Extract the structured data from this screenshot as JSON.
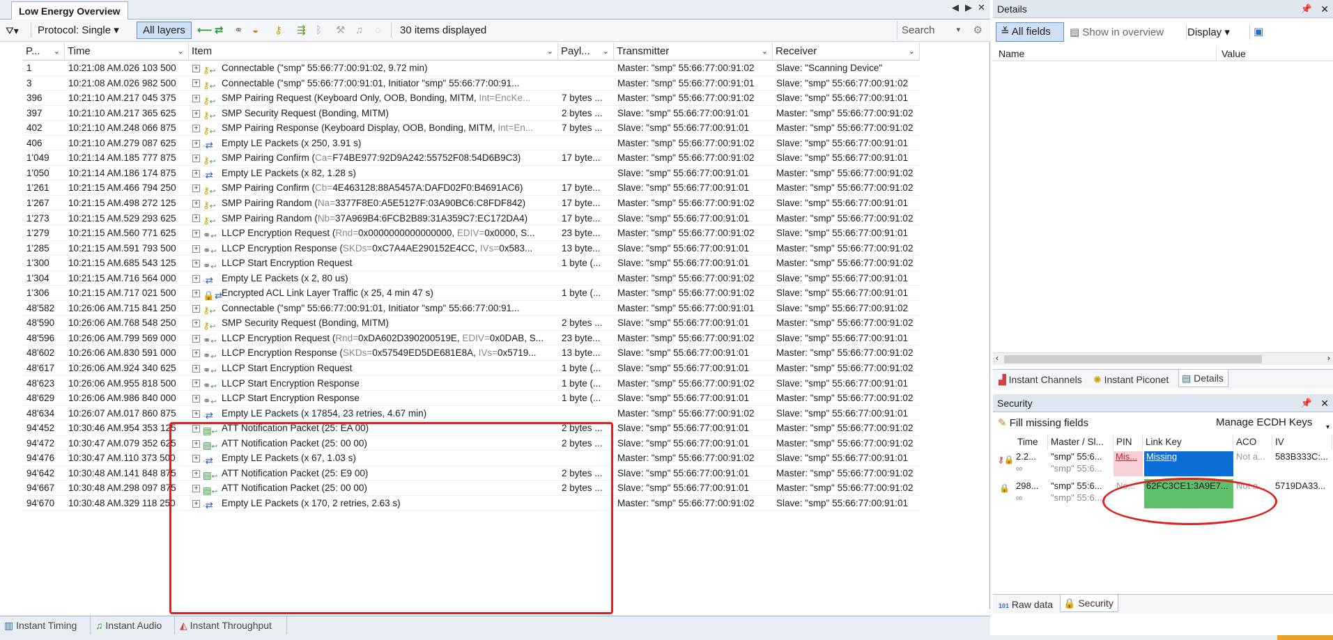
{
  "window": {
    "tab_title": "Low Energy Overview"
  },
  "toolbar": {
    "protocol_label": "Protocol: Single",
    "all_layers_label": "All layers",
    "items_displayed": "30 items displayed",
    "search_placeholder": "Search"
  },
  "columns": {
    "packet": "P...",
    "time": "Time",
    "item": "Item",
    "payload": "Payl...",
    "transmitter": "Transmitter",
    "receiver": "Receiver"
  },
  "rows": [
    {
      "p": "1",
      "t": "10:21:08 AM.026 103 500",
      "icon": "key",
      "item": "Connectable (\"smp\" 55:66:77:00:91:02, 9.72 min)",
      "pl": "",
      "tx": "Master: \"smp\" 55:66:77:00:91:02",
      "rx": "Slave: \"Scanning Device\""
    },
    {
      "p": "3",
      "t": "10:21:08 AM.026 982 500",
      "icon": "key",
      "item": "Connectable (\"smp\" 55:66:77:00:91:01, Initiator \"smp\" 55:66:77:00:91...",
      "pl": "",
      "tx": "Master: \"smp\" 55:66:77:00:91:01",
      "rx": "Slave: \"smp\" 55:66:77:00:91:02"
    },
    {
      "p": "396",
      "t": "10:21:10 AM.217 045 375",
      "icon": "key",
      "item": "SMP Pairing Request (Keyboard Only, OOB, Bonding, MITM, ",
      "gray": "Int=EncKe...",
      "pl": "7 bytes ...",
      "tx": "Master: \"smp\" 55:66:77:00:91:02",
      "rx": "Slave: \"smp\" 55:66:77:00:91:01"
    },
    {
      "p": "397",
      "t": "10:21:10 AM.217 365 625",
      "icon": "key",
      "item": "SMP Security Request (Bonding, MITM)",
      "pl": "2 bytes ...",
      "tx": "Slave: \"smp\" 55:66:77:00:91:01",
      "rx": "Master: \"smp\" 55:66:77:00:91:02"
    },
    {
      "p": "402",
      "t": "10:21:10 AM.248 066 875",
      "icon": "key",
      "item": "SMP Pairing Response (Keyboard Display, OOB, Bonding, MITM, ",
      "gray": "Int=En...",
      "pl": "7 bytes ...",
      "tx": "Slave: \"smp\" 55:66:77:00:91:01",
      "rx": "Master: \"smp\" 55:66:77:00:91:02"
    },
    {
      "p": "406",
      "t": "10:21:10 AM.279 087 625",
      "icon": "empty",
      "item": "Empty LE Packets (x 250, 3.91 s)",
      "pl": "",
      "tx": "Master: \"smp\" 55:66:77:00:91:02",
      "rx": "Slave: \"smp\" 55:66:77:00:91:01"
    },
    {
      "p": "1'049",
      "t": "10:21:14 AM.185 777 875",
      "icon": "key",
      "item": "SMP Pairing Confirm (",
      "gray": "Ca=",
      "rest": "F74BE977:92D9A242:55752F08:54D6B9C3)",
      "pl": "17 byte...",
      "tx": "Master: \"smp\" 55:66:77:00:91:02",
      "rx": "Slave: \"smp\" 55:66:77:00:91:01"
    },
    {
      "p": "1'050",
      "t": "10:21:14 AM.186 174 875",
      "icon": "empty",
      "item": "Empty LE Packets (x 82, 1.28 s)",
      "pl": "",
      "tx": "Slave: \"smp\" 55:66:77:00:91:01",
      "rx": "Master: \"smp\" 55:66:77:00:91:02"
    },
    {
      "p": "1'261",
      "t": "10:21:15 AM.466 794 250",
      "icon": "key",
      "item": "SMP Pairing Confirm (",
      "gray": "Cb=",
      "rest": "4E463128:88A5457A:DAFD02F0:B4691AC6)",
      "pl": "17 byte...",
      "tx": "Slave: \"smp\" 55:66:77:00:91:01",
      "rx": "Master: \"smp\" 55:66:77:00:91:02"
    },
    {
      "p": "1'267",
      "t": "10:21:15 AM.498 272 125",
      "icon": "key",
      "item": "SMP Pairing Random (",
      "gray": "Na=",
      "rest": "3377F8E0:A5E5127F:03A90BC6:C8FDF842)",
      "pl": "17 byte...",
      "tx": "Master: \"smp\" 55:66:77:00:91:02",
      "rx": "Slave: \"smp\" 55:66:77:00:91:01"
    },
    {
      "p": "1'273",
      "t": "10:21:15 AM.529 293 625",
      "icon": "key",
      "item": "SMP Pairing Random (",
      "gray": "Nb=",
      "rest": "37A969B4:6FCB2B89:31A359C7:EC172DA4)",
      "pl": "17 byte...",
      "tx": "Slave: \"smp\" 55:66:77:00:91:01",
      "rx": "Master: \"smp\" 55:66:77:00:91:02"
    },
    {
      "p": "1'279",
      "t": "10:21:15 AM.560 771 625",
      "icon": "llcp",
      "item": "LLCP Encryption Request (",
      "gray": "Rnd=",
      "rest": "0x0000000000000000, ",
      "gray2": "EDIV=",
      "rest2": "0x0000, S...",
      "pl": "23 byte...",
      "tx": "Master: \"smp\" 55:66:77:00:91:02",
      "rx": "Slave: \"smp\" 55:66:77:00:91:01"
    },
    {
      "p": "1'285",
      "t": "10:21:15 AM.591 793 500",
      "icon": "llcp",
      "item": "LLCP Encryption Response (",
      "gray": "SKDs=",
      "rest": "0xC7A4AE290152E4CC, ",
      "gray2": "IVs=",
      "rest2": "0x583...",
      "pl": "13 byte...",
      "tx": "Slave: \"smp\" 55:66:77:00:91:01",
      "rx": "Master: \"smp\" 55:66:77:00:91:02"
    },
    {
      "p": "1'300",
      "t": "10:21:15 AM.685 543 125",
      "icon": "llcp",
      "item": "LLCP Start Encryption Request",
      "pl": "1 byte (...",
      "tx": "Slave: \"smp\" 55:66:77:00:91:01",
      "rx": "Master: \"smp\" 55:66:77:00:91:02"
    },
    {
      "p": "1'304",
      "t": "10:21:15 AM.716 564 000",
      "icon": "empty",
      "item": "Empty LE Packets (x 2, 80 us)",
      "pl": "",
      "tx": "Master: \"smp\" 55:66:77:00:91:02",
      "rx": "Slave: \"smp\" 55:66:77:00:91:01"
    },
    {
      "p": "1'306",
      "t": "10:21:15 AM.717 021 500",
      "icon": "lock",
      "item": "Encrypted ACL Link Layer Traffic  (x 25, 4 min 47 s)",
      "pl": "1 byte (...",
      "tx": "Master: \"smp\" 55:66:77:00:91:02",
      "rx": "Slave: \"smp\" 55:66:77:00:91:01"
    },
    {
      "p": "48'582",
      "t": "10:26:06 AM.715 841 250",
      "icon": "key",
      "item": "Connectable (\"smp\" 55:66:77:00:91:01, Initiator \"smp\" 55:66:77:00:91...",
      "pl": "",
      "tx": "Master: \"smp\" 55:66:77:00:91:01",
      "rx": "Slave: \"smp\" 55:66:77:00:91:02"
    },
    {
      "p": "48'590",
      "t": "10:26:06 AM.768 548 250",
      "icon": "key",
      "item": "SMP Security Request (Bonding, MITM)",
      "pl": "2 bytes ...",
      "tx": "Slave: \"smp\" 55:66:77:00:91:01",
      "rx": "Master: \"smp\" 55:66:77:00:91:02"
    },
    {
      "p": "48'596",
      "t": "10:26:06 AM.799 569 000",
      "icon": "llcp",
      "item": "LLCP Encryption Request (",
      "gray": "Rnd=",
      "rest": "0xDA602D390200519E, ",
      "gray2": "EDIV=",
      "rest2": "0x0DAB, S...",
      "pl": "23 byte...",
      "tx": "Master: \"smp\" 55:66:77:00:91:02",
      "rx": "Slave: \"smp\" 55:66:77:00:91:01"
    },
    {
      "p": "48'602",
      "t": "10:26:06 AM.830 591 000",
      "icon": "llcp",
      "item": "LLCP Encryption Response (",
      "gray": "SKDs=",
      "rest": "0x57549ED5DE681E8A, ",
      "gray2": "IVs=",
      "rest2": "0x5719...",
      "pl": "13 byte...",
      "tx": "Slave: \"smp\" 55:66:77:00:91:01",
      "rx": "Master: \"smp\" 55:66:77:00:91:02"
    },
    {
      "p": "48'617",
      "t": "10:26:06 AM.924 340 625",
      "icon": "llcp",
      "item": "LLCP Start Encryption Request",
      "pl": "1 byte (...",
      "tx": "Slave: \"smp\" 55:66:77:00:91:01",
      "rx": "Master: \"smp\" 55:66:77:00:91:02"
    },
    {
      "p": "48'623",
      "t": "10:26:06 AM.955 818 500",
      "icon": "llcp",
      "item": "LLCP Start Encryption Response",
      "pl": "1 byte (...",
      "tx": "Master: \"smp\" 55:66:77:00:91:02",
      "rx": "Slave: \"smp\" 55:66:77:00:91:01"
    },
    {
      "p": "48'629",
      "t": "10:26:06 AM.986 840 000",
      "icon": "llcp",
      "item": "LLCP Start Encryption Response",
      "pl": "1 byte (...",
      "tx": "Slave: \"smp\" 55:66:77:00:91:01",
      "rx": "Master: \"smp\" 55:66:77:00:91:02"
    },
    {
      "p": "48'634",
      "t": "10:26:07 AM.017 860 875",
      "icon": "empty",
      "item": "Empty LE Packets (x 17854, 23 retries, 4.67 min)",
      "pl": "",
      "tx": "Master: \"smp\" 55:66:77:00:91:02",
      "rx": "Slave: \"smp\" 55:66:77:00:91:01"
    },
    {
      "p": "94'452",
      "t": "10:30:46 AM.954 353 125",
      "icon": "att",
      "item": "ATT Notification Packet (25: EA 00)",
      "pl": "2 bytes ...",
      "tx": "Slave: \"smp\" 55:66:77:00:91:01",
      "rx": "Master: \"smp\" 55:66:77:00:91:02"
    },
    {
      "p": "94'472",
      "t": "10:30:47 AM.079 352 625",
      "icon": "att",
      "item": "ATT Notification Packet (25: 00 00)",
      "pl": "2 bytes ...",
      "tx": "Slave: \"smp\" 55:66:77:00:91:01",
      "rx": "Master: \"smp\" 55:66:77:00:91:02"
    },
    {
      "p": "94'476",
      "t": "10:30:47 AM.110 373 500",
      "icon": "empty",
      "item": "Empty LE Packets (x 67, 1.03 s)",
      "pl": "",
      "tx": "Master: \"smp\" 55:66:77:00:91:02",
      "rx": "Slave: \"smp\" 55:66:77:00:91:01"
    },
    {
      "p": "94'642",
      "t": "10:30:48 AM.141 848 875",
      "icon": "att",
      "item": "ATT Notification Packet (25: E9 00)",
      "pl": "2 bytes ...",
      "tx": "Slave: \"smp\" 55:66:77:00:91:01",
      "rx": "Master: \"smp\" 55:66:77:00:91:02"
    },
    {
      "p": "94'667",
      "t": "10:30:48 AM.298 097 875",
      "icon": "att",
      "item": "ATT Notification Packet (25: 00 00)",
      "pl": "2 bytes ...",
      "tx": "Slave: \"smp\" 55:66:77:00:91:01",
      "rx": "Master: \"smp\" 55:66:77:00:91:02"
    },
    {
      "p": "94'670",
      "t": "10:30:48 AM.329 118 250",
      "icon": "empty",
      "item": "Empty LE Packets (x 170, 2 retries, 2.63 s)",
      "pl": "",
      "tx": "Master: \"smp\" 55:66:77:00:91:02",
      "rx": "Slave: \"smp\" 55:66:77:00:91:01"
    }
  ],
  "bottom_tabs": [
    "Instant Timing",
    "Instant Audio",
    "Instant Throughput"
  ],
  "details": {
    "title": "Details",
    "all_fields_label": "All fields",
    "show_in_overview_label": "Show in overview",
    "display_label": "Display",
    "name_col": "Name",
    "value_col": "Value",
    "tabs": [
      "Instant Channels",
      "Instant Piconet",
      "Details"
    ]
  },
  "security": {
    "title": "Security",
    "fill_missing_label": "Fill missing fields",
    "manage_ecdh_label": "Manage ECDH Keys",
    "columns": [
      "Time",
      "Master / Sl...",
      "PIN",
      "Link Key",
      "ACO",
      "IV"
    ],
    "rows": [
      {
        "time": "2.2...",
        "time2": "∞",
        "ms": "\"smp\" 55:6...",
        "ms2": "\"smp\" 55:6...",
        "pin": "Mis...",
        "key": "Missing",
        "aco": "Not a...",
        "iv": "583B333C:..."
      },
      {
        "time": "298...",
        "time2": "∞",
        "ms": "\"smp\" 55:6...",
        "ms2": "\"smp\" 55:6...",
        "pin": "No...",
        "key": "62FC3CE1:3A9E7...",
        "aco": "Not a...",
        "iv": "5719DA33..."
      }
    ],
    "tabs": [
      "Raw data",
      "Security"
    ]
  },
  "colors": {
    "accent": "#5b8fd1",
    "missing_blue": "#0c6fd8",
    "key_green": "#5fbf6a",
    "highlight_red": "#e02020",
    "pin_pink": "#f6d0d6"
  }
}
